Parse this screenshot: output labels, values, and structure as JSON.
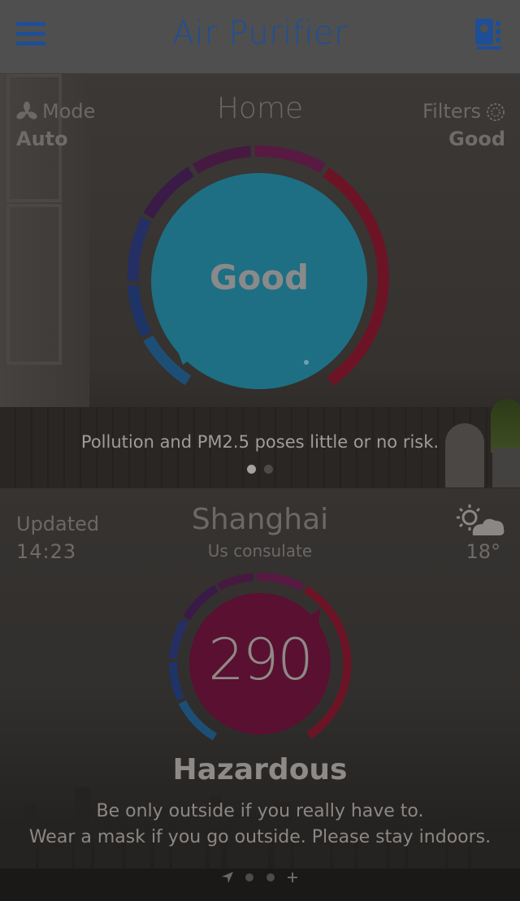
{
  "header": {
    "title": "Air Purifier",
    "menu_icon": "hamburger-menu-icon",
    "device_icon": "purifier-device-icon"
  },
  "home": {
    "title": "Home",
    "mode_label": "Mode",
    "mode_value": "Auto",
    "filters_label": "Filters",
    "filters_value": "Good",
    "air_quality": "Good",
    "status_message": "Pollution and PM2.5 poses little or no risk.",
    "page_count": 2,
    "active_page": 0
  },
  "city": {
    "updated_label": "Updated",
    "updated_time": "14:23",
    "name": "Shanghai",
    "station": "Us consulate",
    "temperature": "18°",
    "weather_icon": "partly-sunny-icon",
    "aqi": "290",
    "level": "Hazardous",
    "advice_line1": "Be only outside if you really have to.",
    "advice_line2": "Wear a mask if you go outside. Please stay indoors.",
    "location_icon": "location-arrow-icon",
    "add_icon": "add-plus-icon"
  },
  "colors": {
    "header_blue": "#1e4f96",
    "good_teal": "#1e6f83",
    "hazard_red": "#5a1030",
    "ring_red": "#7a1526",
    "ring_purple": "#4a1740",
    "ring_blue": "#1f3466"
  }
}
